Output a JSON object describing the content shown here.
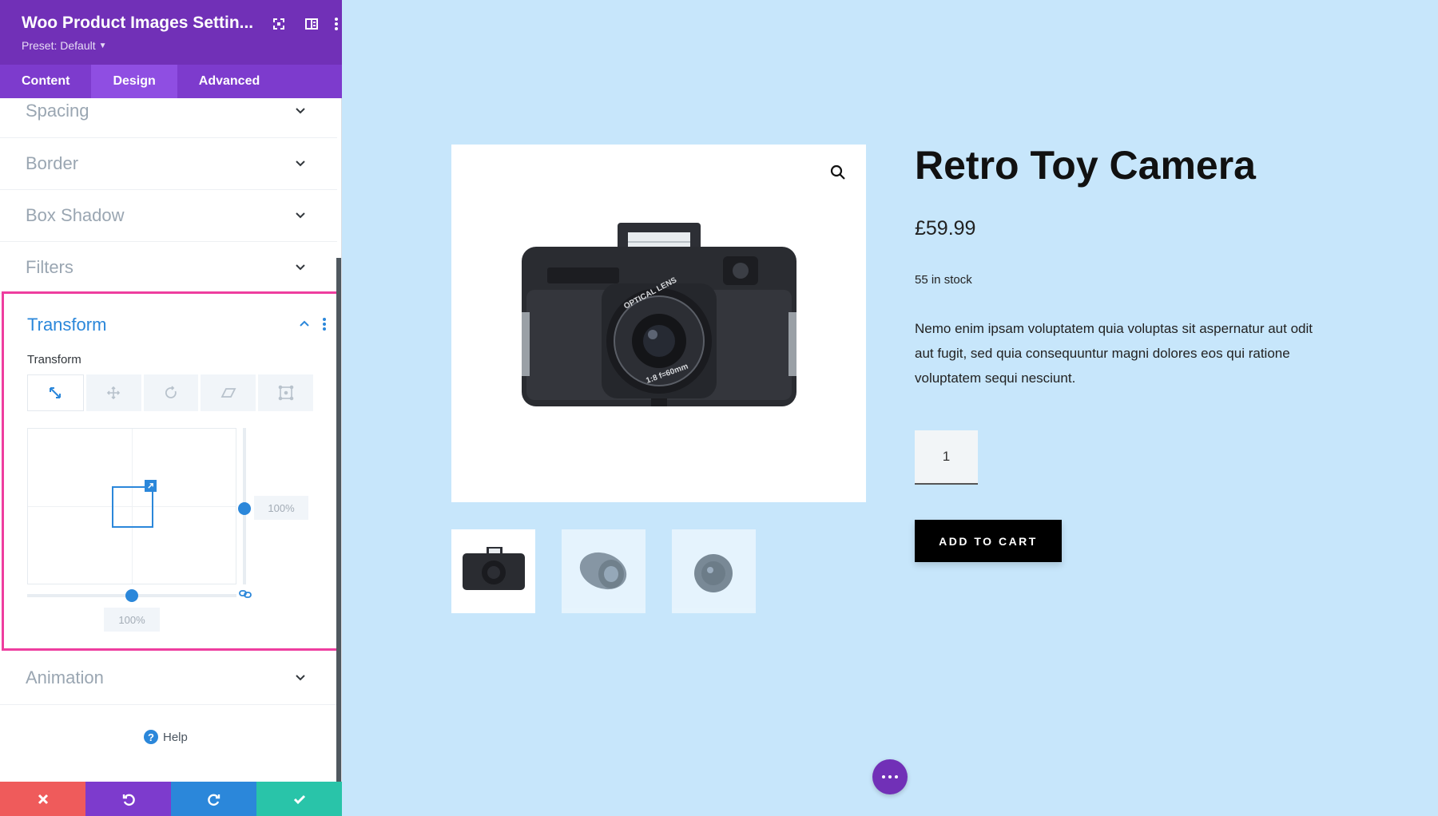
{
  "colors": {
    "panel_header": "#7130b7",
    "tab_bar": "#7d3bcd",
    "tab_active": "#8f4ee2",
    "accent_blue": "#2b87da",
    "highlight_pink": "#ee3e9f",
    "preview_bg": "#c7e6fb",
    "footer_cancel": "#ef5b5b",
    "footer_undo": "#7d3bcd",
    "footer_redo": "#2b87da",
    "footer_save": "#29c4a9"
  },
  "panel": {
    "title": "Woo Product Images Settin...",
    "preset": "Preset: Default",
    "header_icons": [
      "fullscreen-icon",
      "split-view-icon",
      "more-vertical-icon"
    ],
    "tabs": [
      {
        "label": "Content",
        "active": false
      },
      {
        "label": "Design",
        "active": true
      },
      {
        "label": "Advanced",
        "active": false
      }
    ],
    "sections": {
      "spacing": "Spacing",
      "border": "Border",
      "box_shadow": "Box Shadow",
      "filters": "Filters",
      "animation": "Animation"
    },
    "transform": {
      "title": "Transform",
      "sublabel": "Transform",
      "types": [
        "scale-icon",
        "translate-icon",
        "rotate-icon",
        "skew-icon",
        "origin-icon"
      ],
      "active_type": "scale",
      "scale_x": "100%",
      "scale_y": "100%"
    },
    "help": "Help",
    "footer": [
      "close-icon",
      "undo-icon",
      "redo-icon",
      "check-icon"
    ]
  },
  "product": {
    "title": "Retro Toy Camera",
    "price": "£59.99",
    "stock": "55 in stock",
    "description": "Nemo enim ipsam voluptatem quia voluptas sit aspernatur aut odit aut fugit, sed quia consequuntur magni dolores eos qui ratione voluptatem sequi nesciunt.",
    "quantity": "1",
    "add_to_cart": "ADD TO CART",
    "lens_text_1": "OPTICAL LENS",
    "lens_text_2": "1:8  f=60mm"
  }
}
